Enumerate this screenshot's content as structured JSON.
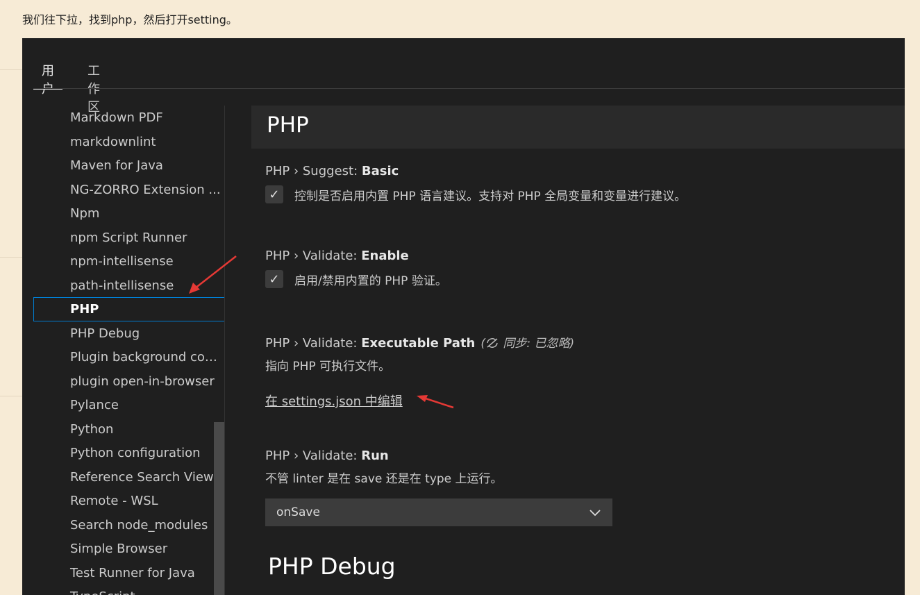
{
  "intro_text": "我们往下拉，找到php，然后打开setting。",
  "tabs": [
    {
      "label": "用户",
      "active": true
    },
    {
      "label": "工作区",
      "active": false
    }
  ],
  "tree": [
    {
      "label": "Markdown PDF"
    },
    {
      "label": "markdownlint"
    },
    {
      "label": "Maven for Java"
    },
    {
      "label": "NG-ZORRO Extension ..."
    },
    {
      "label": "Npm"
    },
    {
      "label": "npm Script Runner"
    },
    {
      "label": "npm-intellisense"
    },
    {
      "label": "path-intellisense"
    },
    {
      "label": "PHP",
      "selected": true
    },
    {
      "label": "PHP Debug"
    },
    {
      "label": "Plugin background conf..."
    },
    {
      "label": "plugin open-in-browser"
    },
    {
      "label": "Pylance"
    },
    {
      "label": "Python"
    },
    {
      "label": "Python configuration"
    },
    {
      "label": "Reference Search View"
    },
    {
      "label": "Remote - WSL"
    },
    {
      "label": "Search node_modules"
    },
    {
      "label": "Simple Browser"
    },
    {
      "label": "Test Runner for Java"
    },
    {
      "label": "TypeScript"
    }
  ],
  "section_title": "PHP",
  "settings": {
    "suggest_basic": {
      "prefix": "PHP › Suggest: ",
      "name": "Basic",
      "checked": true,
      "description": "控制是否启用内置 PHP 语言建议。支持对 PHP 全局变量和变量进行建议。"
    },
    "validate_enable": {
      "prefix": "PHP › Validate: ",
      "name": "Enable",
      "checked": true,
      "description": "启用/禁用内置的 PHP 验证。"
    },
    "validate_executable_path": {
      "prefix": "PHP › Validate: ",
      "name": "Executable Path",
      "sync_note": "同步: 已忽略)",
      "description": "指向 PHP 可执行文件。",
      "link": "在 settings.json 中编辑"
    },
    "validate_run": {
      "prefix": "PHP › Validate: ",
      "name": "Run",
      "description": "不管 linter 是在 save 还是在 type 上运行。",
      "value": "onSave"
    }
  },
  "next_section_title": "PHP Debug",
  "icons": {
    "check": "check-icon",
    "chevron": "chevron-down-icon",
    "sync_ignored": "sync-ignored-icon"
  },
  "colors": {
    "page_bg": "#f7ebd6",
    "editor_bg": "#1f1f1f",
    "selection_border": "#007fd4",
    "annotation_arrow": "#e53935"
  }
}
